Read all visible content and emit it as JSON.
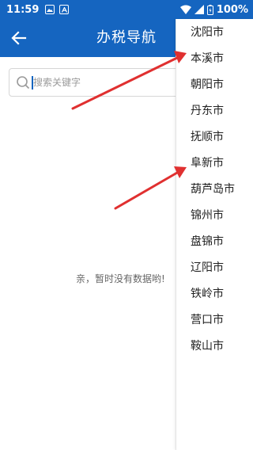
{
  "statusbar": {
    "time": "11:59",
    "battery": "100%",
    "notif_icons": [
      "image-icon",
      "a-icon"
    ]
  },
  "appbar": {
    "title": "办税导航",
    "back_icon": "arrow-left-icon"
  },
  "search": {
    "placeholder": "搜索关键字",
    "value": ""
  },
  "empty_state": {
    "text": "亲，暂时没有数据哟!"
  },
  "city_dropdown": {
    "items": [
      {
        "label": "沈阳市"
      },
      {
        "label": "本溪市"
      },
      {
        "label": "朝阳市"
      },
      {
        "label": "丹东市"
      },
      {
        "label": "抚顺市"
      },
      {
        "label": "阜新市"
      },
      {
        "label": "葫芦岛市"
      },
      {
        "label": "锦州市"
      },
      {
        "label": "盘锦市"
      },
      {
        "label": "辽阳市"
      },
      {
        "label": "铁岭市"
      },
      {
        "label": "营口市"
      },
      {
        "label": "鞍山市"
      }
    ]
  },
  "colors": {
    "primary": "#1565c0",
    "annotation_arrow": "#e03030"
  }
}
